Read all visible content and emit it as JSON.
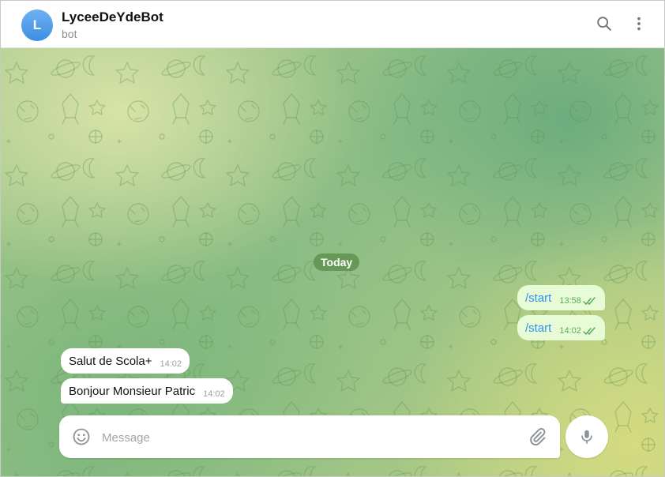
{
  "header": {
    "avatar_letter": "L",
    "title": "LyceeDeYdeBot",
    "subtitle": "bot",
    "search_icon": "search-icon",
    "menu_icon": "more-vertical-icon"
  },
  "chat": {
    "date_label": "Today",
    "messages": [
      {
        "direction": "outgoing",
        "text": "/start",
        "time": "13:58",
        "status": "read"
      },
      {
        "direction": "outgoing",
        "text": "/start",
        "time": "14:02",
        "status": "read"
      },
      {
        "direction": "incoming",
        "text": "Salut de Scola+",
        "time": "14:02"
      },
      {
        "direction": "incoming",
        "text": "Bonjour Monsieur Patric",
        "time": "14:02"
      }
    ]
  },
  "composer": {
    "placeholder": "Message",
    "value": "",
    "emoji_icon": "smile-icon",
    "attach_icon": "paperclip-icon",
    "mic_icon": "microphone-icon"
  },
  "colors": {
    "accent": "#3390ec",
    "outgoing_bubble": "#e7fbd6",
    "read_ticks": "#5bab5f",
    "date_pill": "#6a9e5a"
  }
}
